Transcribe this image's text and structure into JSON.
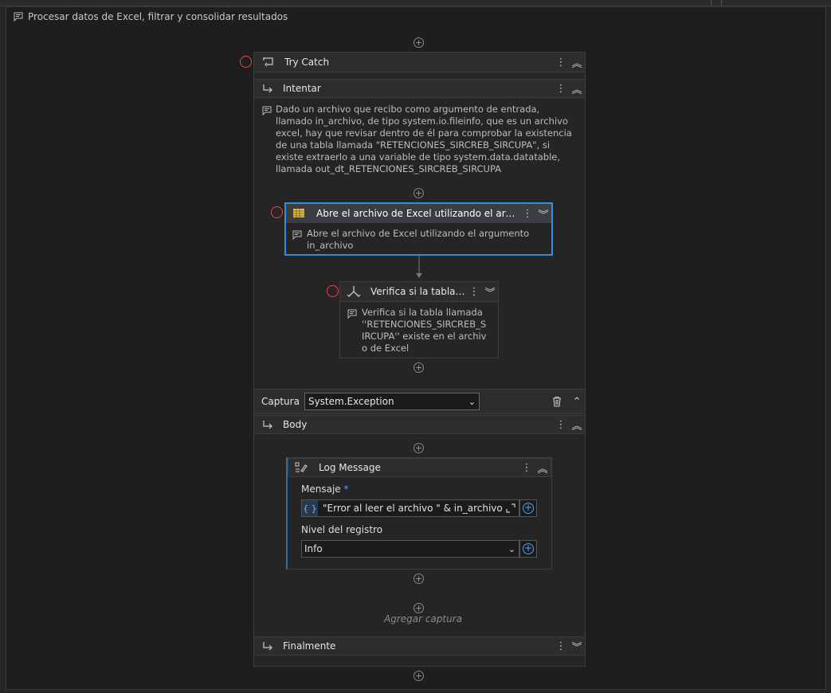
{
  "annotation": {
    "text": "Procesar datos de Excel, filtrar y consolidar resultados"
  },
  "try_catch": {
    "title": "Try Catch",
    "try_section": {
      "title": "Intentar",
      "comment": "Dado un archivo que recibo como argumento de entrada, llamado in_archivo, de tipo system.io.fileinfo, que es un archivo excel, hay que revisar dentro de él para comprobar la existencia de una tabla llamada \"RETENCIONES_SIRCREB_SIRCUPA\", si existe extraerlo a una variable de tipo system.data.datatable, llamada out_dt_RETENCIONES_SIRCREB_SIRCUPA"
    },
    "activity_open_excel": {
      "title": "Abre el archivo de Excel utilizando el argume...",
      "comment": "Abre el archivo de Excel utilizando el argumento in_archivo"
    },
    "activity_check_table": {
      "title": "Verifica si la tabla ll...",
      "comment": "Verifica si la tabla llamada ''RETENCIONES_SIRCREB_SIRCUPA'' existe en el archivo de Excel"
    },
    "catch_section": {
      "label": "Captura",
      "exception_type": "System.Exception",
      "body_title": "Body"
    },
    "log_message": {
      "title": "Log Message",
      "message_label": "Mensaje",
      "required_mark": "*",
      "message_value": "\"Error al leer el archivo \" & in_archivo & \"",
      "level_label": "Nivel del registro",
      "level_value": "Info"
    },
    "add_catch_label": "Agregar captura",
    "finally_title": "Finalmente"
  },
  "icons": {
    "kebab": "⋮",
    "collapse": "⌃",
    "expand": "⌄",
    "plus": "+"
  },
  "colors": {
    "selected_border": "#2f8fe0",
    "breakpoint": "#e5484d",
    "accent_blue": "#4aa3ff"
  }
}
